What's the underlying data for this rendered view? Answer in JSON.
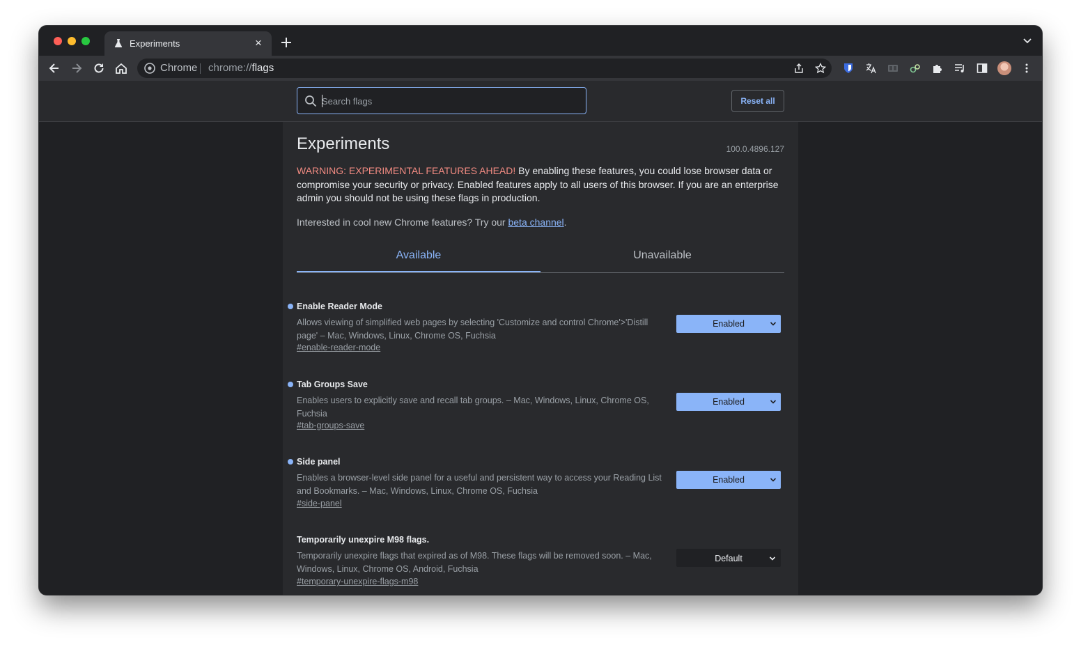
{
  "tab": {
    "title": "Experiments",
    "close_icon": "close-icon"
  },
  "omnibox": {
    "chip_label": "Chrome",
    "url_scheme": "chrome://",
    "url_path": "flags"
  },
  "header": {
    "search_placeholder": "Search flags",
    "reset_label": "Reset all"
  },
  "main": {
    "title": "Experiments",
    "version": "100.0.4896.127",
    "warning_prefix": "WARNING: EXPERIMENTAL FEATURES AHEAD!",
    "warning_text": " By enabling these features, you could lose browser data or compromise your security or privacy. Enabled features apply to all users of this browser. If you are an enterprise admin you should not be using these flags in production.",
    "interested_text": "Interested in cool new Chrome features? Try our ",
    "beta_link": "beta channel",
    "interested_suffix": ".",
    "tabs": [
      {
        "label": "Available"
      },
      {
        "label": "Unavailable"
      }
    ]
  },
  "flags": [
    {
      "name": "Enable Reader Mode",
      "description": "Allows viewing of simplified web pages by selecting 'Customize and control Chrome'>'Distill page' – Mac, Windows, Linux, Chrome OS, Fuchsia",
      "link": "#enable-reader-mode",
      "value": "Enabled"
    },
    {
      "name": "Tab Groups Save",
      "description": "Enables users to explicitly save and recall tab groups. – Mac, Windows, Linux, Chrome OS, Fuchsia",
      "link": "#tab-groups-save",
      "value": "Enabled"
    },
    {
      "name": "Side panel",
      "description": "Enables a browser-level side panel for a useful and persistent way to access your Reading List and Bookmarks. – Mac, Windows, Linux, Chrome OS, Fuchsia",
      "link": "#side-panel",
      "value": "Enabled"
    },
    {
      "name": "Temporarily unexpire M98 flags.",
      "description": "Temporarily unexpire flags that expired as of M98. These flags will be removed soon. – Mac, Windows, Linux, Chrome OS, Android, Fuchsia",
      "link": "#temporary-unexpire-flags-m98",
      "value": "Default"
    }
  ],
  "colors": {
    "accent": "#8ab4f8",
    "warning": "#f28b82",
    "background": "#202124",
    "panel": "#292a2d"
  }
}
